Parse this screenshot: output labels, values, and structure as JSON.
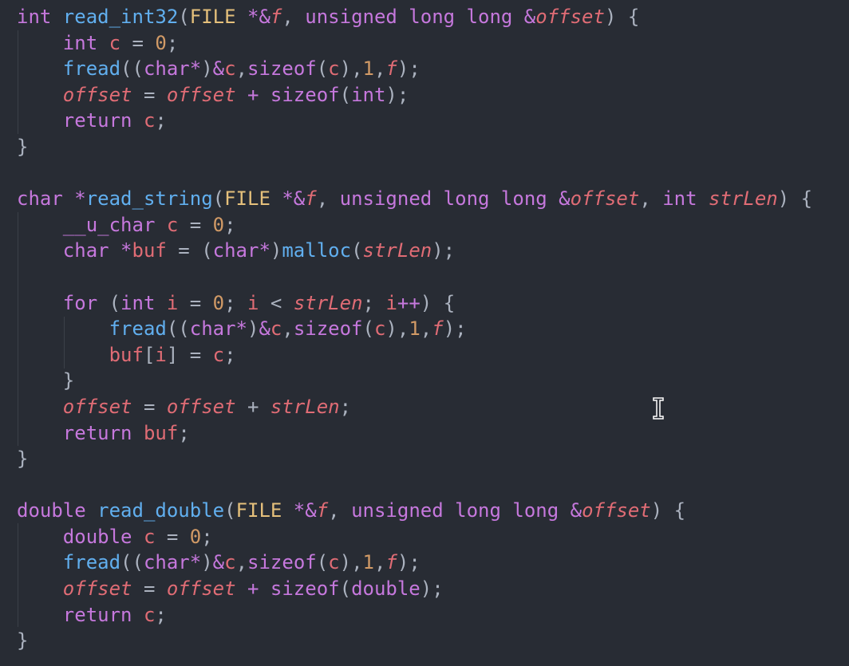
{
  "editor": {
    "theme_colors": {
      "background": "#282c34",
      "keyword": "#c678dd",
      "function": "#61afef",
      "type": "#e5c07b",
      "variable": "#e06c75",
      "number": "#d19a66",
      "punctuation": "#abb2bf"
    },
    "lines": [
      [
        [
          "k",
          "int "
        ],
        [
          "f",
          "read_int32"
        ],
        [
          "p",
          "("
        ],
        [
          "t",
          "FILE"
        ],
        [
          "k",
          " *&"
        ],
        [
          "i",
          "f"
        ],
        [
          "p",
          ", "
        ],
        [
          "k",
          "unsigned long long &"
        ],
        [
          "i",
          "offset"
        ],
        [
          "p",
          ") {"
        ]
      ],
      [
        [
          "p",
          "    "
        ],
        [
          "k",
          "int "
        ],
        [
          "v",
          "c"
        ],
        [
          "p",
          " = "
        ],
        [
          "n",
          "0"
        ],
        [
          "p",
          ";"
        ]
      ],
      [
        [
          "p",
          "    "
        ],
        [
          "f",
          "fread"
        ],
        [
          "p",
          "(("
        ],
        [
          "k",
          "char*"
        ],
        [
          "p",
          ")"
        ],
        [
          "k",
          "&"
        ],
        [
          "v",
          "c"
        ],
        [
          "p",
          ","
        ],
        [
          "k",
          "sizeof"
        ],
        [
          "p",
          "("
        ],
        [
          "v",
          "c"
        ],
        [
          "p",
          "),"
        ],
        [
          "n",
          "1"
        ],
        [
          "p",
          ","
        ],
        [
          "i",
          "f"
        ],
        [
          "p",
          ");"
        ]
      ],
      [
        [
          "p",
          "    "
        ],
        [
          "i",
          "offset"
        ],
        [
          "p",
          " = "
        ],
        [
          "i",
          "offset"
        ],
        [
          "k",
          " + sizeof"
        ],
        [
          "p",
          "("
        ],
        [
          "k",
          "int"
        ],
        [
          "p",
          ");"
        ]
      ],
      [
        [
          "p",
          "    "
        ],
        [
          "k",
          "return "
        ],
        [
          "v",
          "c"
        ],
        [
          "p",
          ";"
        ]
      ],
      [
        [
          "p",
          "}"
        ]
      ],
      [
        [
          "p",
          ""
        ]
      ],
      [
        [
          "k",
          "char *"
        ],
        [
          "f",
          "read_string"
        ],
        [
          "p",
          "("
        ],
        [
          "t",
          "FILE"
        ],
        [
          "k",
          " *&"
        ],
        [
          "i",
          "f"
        ],
        [
          "p",
          ", "
        ],
        [
          "k",
          "unsigned long long &"
        ],
        [
          "i",
          "offset"
        ],
        [
          "p",
          ", "
        ],
        [
          "k",
          "int "
        ],
        [
          "i",
          "strLen"
        ],
        [
          "p",
          ") {"
        ]
      ],
      [
        [
          "p",
          "    "
        ],
        [
          "k",
          "__u_char "
        ],
        [
          "v",
          "c"
        ],
        [
          "p",
          " = "
        ],
        [
          "n",
          "0"
        ],
        [
          "p",
          ";"
        ]
      ],
      [
        [
          "p",
          "    "
        ],
        [
          "k",
          "char *"
        ],
        [
          "v",
          "buf"
        ],
        [
          "p",
          " = ("
        ],
        [
          "k",
          "char*"
        ],
        [
          "p",
          ")"
        ],
        [
          "f",
          "malloc"
        ],
        [
          "p",
          "("
        ],
        [
          "i",
          "strLen"
        ],
        [
          "p",
          ");"
        ]
      ],
      [
        [
          "p",
          ""
        ]
      ],
      [
        [
          "p",
          "    "
        ],
        [
          "k",
          "for "
        ],
        [
          "p",
          "("
        ],
        [
          "k",
          "int "
        ],
        [
          "v",
          "i"
        ],
        [
          "p",
          " = "
        ],
        [
          "n",
          "0"
        ],
        [
          "p",
          "; "
        ],
        [
          "v",
          "i"
        ],
        [
          "p",
          " < "
        ],
        [
          "i",
          "strLen"
        ],
        [
          "p",
          "; "
        ],
        [
          "v",
          "i"
        ],
        [
          "k",
          "++"
        ],
        [
          "p",
          ") {"
        ]
      ],
      [
        [
          "p",
          "        "
        ],
        [
          "f",
          "fread"
        ],
        [
          "p",
          "(("
        ],
        [
          "k",
          "char*"
        ],
        [
          "p",
          ")"
        ],
        [
          "k",
          "&"
        ],
        [
          "v",
          "c"
        ],
        [
          "p",
          ","
        ],
        [
          "k",
          "sizeof"
        ],
        [
          "p",
          "("
        ],
        [
          "v",
          "c"
        ],
        [
          "p",
          "),"
        ],
        [
          "n",
          "1"
        ],
        [
          "p",
          ","
        ],
        [
          "i",
          "f"
        ],
        [
          "p",
          ");"
        ]
      ],
      [
        [
          "p",
          "        "
        ],
        [
          "v",
          "buf"
        ],
        [
          "p",
          "["
        ],
        [
          "v",
          "i"
        ],
        [
          "p",
          "] = "
        ],
        [
          "v",
          "c"
        ],
        [
          "p",
          ";"
        ]
      ],
      [
        [
          "p",
          "    }"
        ]
      ],
      [
        [
          "p",
          "    "
        ],
        [
          "i",
          "offset"
        ],
        [
          "p",
          " = "
        ],
        [
          "i",
          "offset"
        ],
        [
          "p",
          " + "
        ],
        [
          "i",
          "strLen"
        ],
        [
          "p",
          ";"
        ]
      ],
      [
        [
          "p",
          "    "
        ],
        [
          "k",
          "return "
        ],
        [
          "v",
          "buf"
        ],
        [
          "p",
          ";"
        ]
      ],
      [
        [
          "p",
          "}"
        ]
      ],
      [
        [
          "p",
          ""
        ]
      ],
      [
        [
          "k",
          "double "
        ],
        [
          "f",
          "read_double"
        ],
        [
          "p",
          "("
        ],
        [
          "t",
          "FILE"
        ],
        [
          "k",
          " *&"
        ],
        [
          "i",
          "f"
        ],
        [
          "p",
          ", "
        ],
        [
          "k",
          "unsigned long long &"
        ],
        [
          "i",
          "offset"
        ],
        [
          "p",
          ") {"
        ]
      ],
      [
        [
          "p",
          "    "
        ],
        [
          "k",
          "double "
        ],
        [
          "v",
          "c"
        ],
        [
          "p",
          " = "
        ],
        [
          "n",
          "0"
        ],
        [
          "p",
          ";"
        ]
      ],
      [
        [
          "p",
          "    "
        ],
        [
          "f",
          "fread"
        ],
        [
          "p",
          "(("
        ],
        [
          "k",
          "char*"
        ],
        [
          "p",
          ")"
        ],
        [
          "k",
          "&"
        ],
        [
          "v",
          "c"
        ],
        [
          "p",
          ","
        ],
        [
          "k",
          "sizeof"
        ],
        [
          "p",
          "("
        ],
        [
          "v",
          "c"
        ],
        [
          "p",
          "),"
        ],
        [
          "n",
          "1"
        ],
        [
          "p",
          ","
        ],
        [
          "i",
          "f"
        ],
        [
          "p",
          ");"
        ]
      ],
      [
        [
          "p",
          "    "
        ],
        [
          "i",
          "offset"
        ],
        [
          "p",
          " = "
        ],
        [
          "i",
          "offset"
        ],
        [
          "k",
          " + sizeof"
        ],
        [
          "p",
          "("
        ],
        [
          "k",
          "double"
        ],
        [
          "p",
          ");"
        ]
      ],
      [
        [
          "p",
          "    "
        ],
        [
          "k",
          "return "
        ],
        [
          "v",
          "c"
        ],
        [
          "p",
          ";"
        ]
      ],
      [
        [
          "p",
          "}"
        ]
      ]
    ]
  },
  "cursor": {
    "icon": "text-cursor-ibeam-icon"
  }
}
